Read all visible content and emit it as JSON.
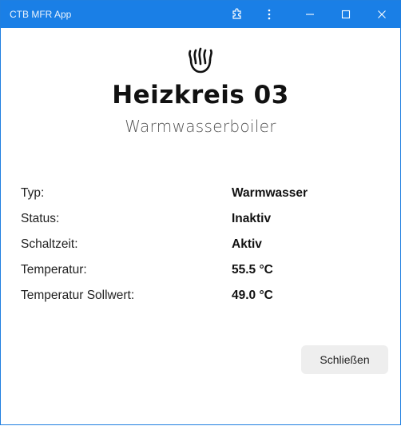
{
  "window": {
    "title": "CTB MFR App",
    "controls": [
      "extension-icon",
      "more-vertical-icon",
      "minimize-icon",
      "maximize-icon",
      "close-icon"
    ]
  },
  "header": {
    "icon": "flame-icon",
    "title": "Heizkreis 03",
    "subtitle": "Warmwasserboiler"
  },
  "properties": [
    {
      "label": "Typ:",
      "value": "Warmwasser"
    },
    {
      "label": "Status:",
      "value": "Inaktiv"
    },
    {
      "label": "Schaltzeit:",
      "value": "Aktiv"
    },
    {
      "label": "Temperatur:",
      "value": "55.5 °C"
    },
    {
      "label": "Temperatur Sollwert:",
      "value": "49.0 °C"
    }
  ],
  "actions": {
    "close_label": "Schließen"
  },
  "colors": {
    "titlebar": "#1a7fe6",
    "button_bg": "#eeeeee"
  }
}
